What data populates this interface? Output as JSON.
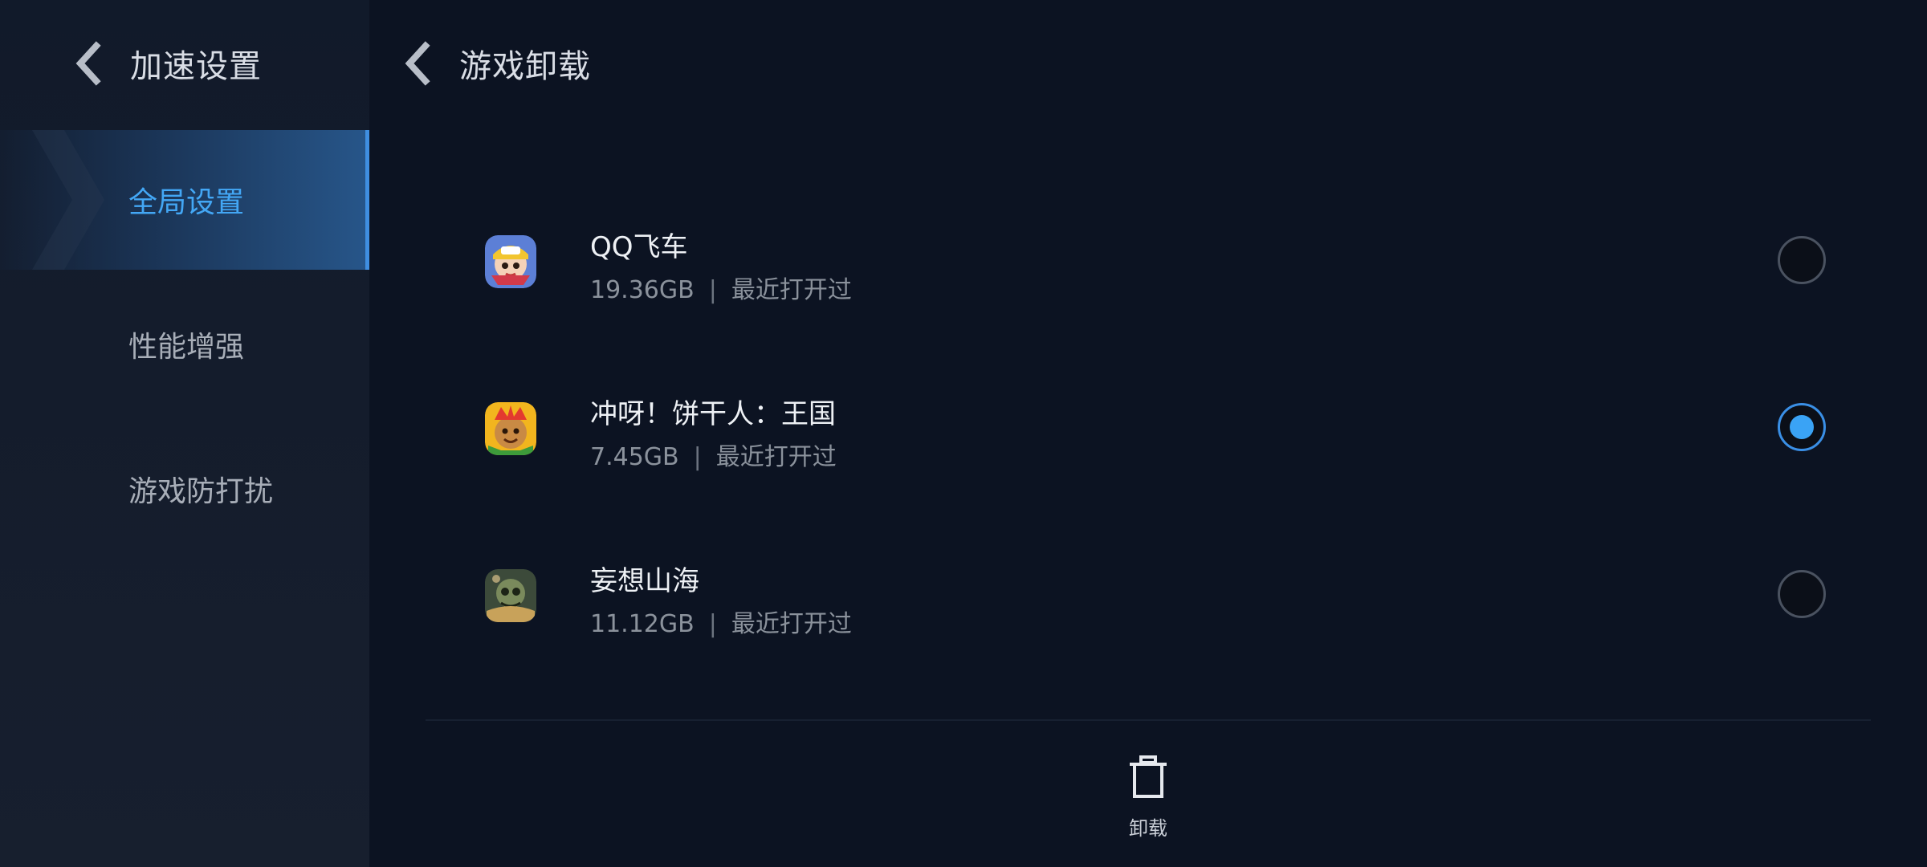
{
  "left_header": {
    "title": "加速设置"
  },
  "right_header": {
    "title": "游戏卸载"
  },
  "nav": {
    "items": [
      {
        "label": "全局设置",
        "active": true
      },
      {
        "label": "性能增强",
        "active": false
      },
      {
        "label": "游戏防打扰",
        "active": false
      }
    ]
  },
  "games": [
    {
      "name": "QQ飞车",
      "size": "19.36GB",
      "sep": "|",
      "status": "最近打开过",
      "selected": false,
      "icon": "qq-speed-icon"
    },
    {
      "name": "冲呀！饼干人：王国",
      "size": "7.45GB",
      "sep": "|",
      "status": "最近打开过",
      "selected": true,
      "icon": "cookie-run-icon"
    },
    {
      "name": "妄想山海",
      "size": "11.12GB",
      "sep": "|",
      "status": "最近打开过",
      "selected": false,
      "icon": "wangxiang-shanhai-icon"
    }
  ],
  "actions": {
    "uninstall_label": "卸载"
  },
  "colors": {
    "accent": "#3aa3f5",
    "background": "#0c1322",
    "active_nav_text": "#43a7f5"
  }
}
